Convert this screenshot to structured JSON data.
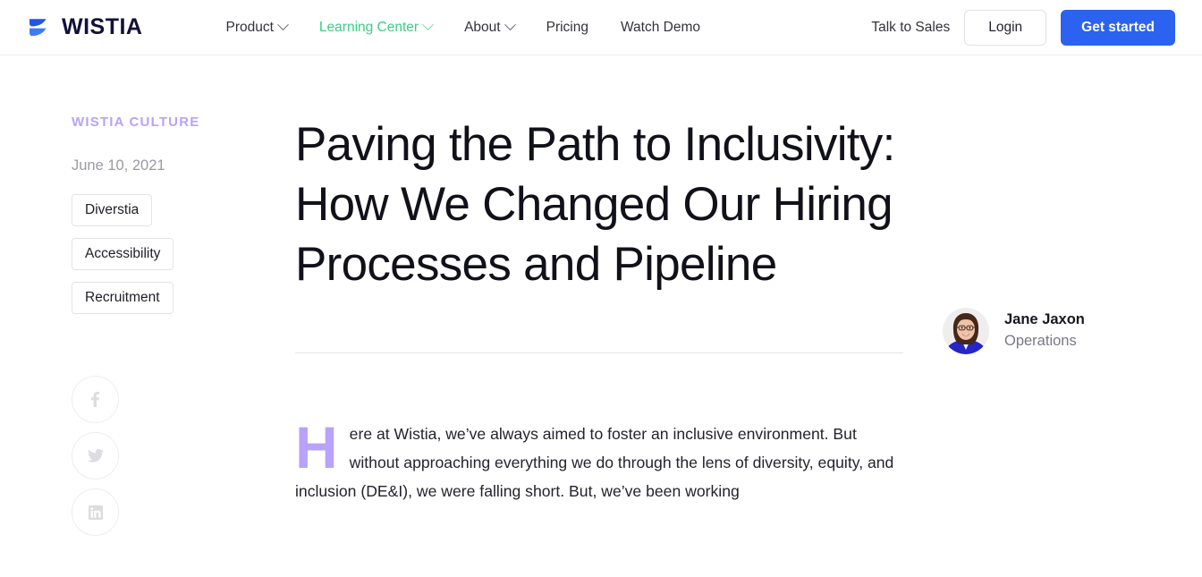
{
  "header": {
    "logo": {
      "word": "WISTIA",
      "icon": "wistia-swoosh-icon"
    },
    "nav": [
      {
        "label": "Product",
        "has_dropdown": true,
        "active": false
      },
      {
        "label": "Learning Center",
        "has_dropdown": true,
        "active": true
      },
      {
        "label": "About",
        "has_dropdown": true,
        "active": false
      },
      {
        "label": "Pricing",
        "has_dropdown": false,
        "active": false
      },
      {
        "label": "Watch Demo",
        "has_dropdown": false,
        "active": false
      }
    ],
    "talk_to_sales": "Talk to Sales",
    "login": "Login",
    "get_started": "Get started",
    "accent_green": "#3ace86",
    "accent_blue": "#2b62f0"
  },
  "sidebar": {
    "kicker": "WISTIA CULTURE",
    "date": "June 10, 2021",
    "tags": [
      "Diverstia",
      "Accessibility",
      "Recruitment"
    ],
    "social": [
      {
        "name": "facebook-icon",
        "label": "Share on Facebook"
      },
      {
        "name": "twitter-icon",
        "label": "Share on Twitter"
      },
      {
        "name": "linkedin-icon",
        "label": "Share on LinkedIn"
      }
    ],
    "kicker_color": "#b9a2fb"
  },
  "article": {
    "title": "Paving the Path to Inclusivity: How We Changed Our Hiring Processes and Pipeline",
    "dropcap": "H",
    "body": "ere at Wistia, we’ve always aimed to foster an inclusive environment. But without approaching everything we do through the lens of diversity, equity, and inclusion (DE&I), we were falling short. But, we’ve been working",
    "dropcap_color": "#b9a2fb"
  },
  "author": {
    "name": "Jane Jaxon",
    "role": "Operations",
    "avatar": "author-headshot"
  }
}
